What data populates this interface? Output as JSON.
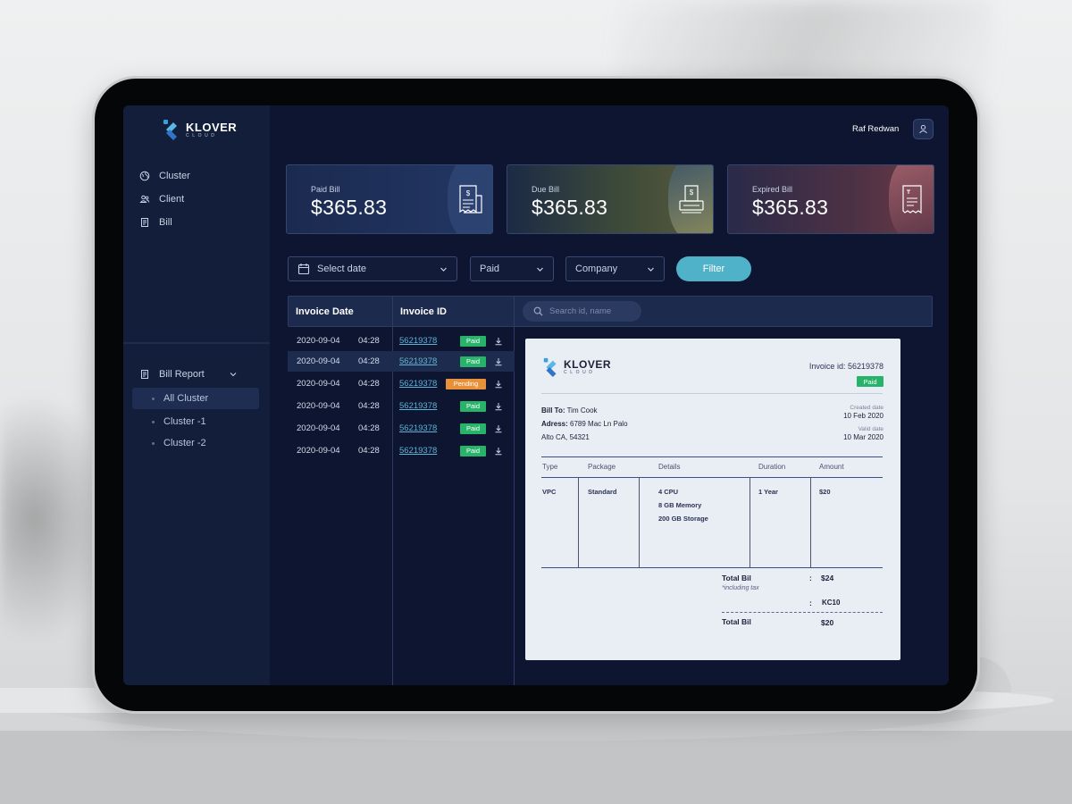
{
  "brand": {
    "name": "KLOVER",
    "sub": "CLOUD"
  },
  "sidebar": {
    "items": [
      {
        "label": "Cluster",
        "icon": "globe-icon"
      },
      {
        "label": "Client",
        "icon": "users-icon"
      },
      {
        "label": "Bill",
        "icon": "receipt-icon"
      }
    ],
    "report": {
      "label": "Bill Report",
      "children": [
        "All Cluster",
        "Cluster -1",
        "Cluster -2"
      ],
      "active": "All Cluster"
    }
  },
  "header": {
    "user_name": "Raf Redwan"
  },
  "cards": [
    {
      "label": "Paid Bill",
      "value": "$365.83"
    },
    {
      "label": "Due Bill",
      "value": "$365.83"
    },
    {
      "label": "Expired Bill",
      "value": "$365.83"
    }
  ],
  "filters": {
    "date_placeholder": "Select date",
    "status": "Paid",
    "company": "Company",
    "button": "Filter"
  },
  "table": {
    "headers": [
      "Invoice Date",
      "Invoice ID"
    ],
    "search_placeholder": "Search id, name",
    "rows": [
      {
        "date": "2020-09-04",
        "time": "04:28",
        "id": "56219378",
        "status": "Paid"
      },
      {
        "date": "2020-09-04",
        "time": "04:28",
        "id": "56219378",
        "status": "Paid"
      },
      {
        "date": "2020-09-04",
        "time": "04:28",
        "id": "56219378",
        "status": "Pending"
      },
      {
        "date": "2020-09-04",
        "time": "04:28",
        "id": "56219378",
        "status": "Paid"
      },
      {
        "date": "2020-09-04",
        "time": "04:28",
        "id": "56219378",
        "status": "Paid"
      },
      {
        "date": "2020-09-04",
        "time": "04:28",
        "id": "56219378",
        "status": "Paid"
      }
    ]
  },
  "invoice": {
    "id_text": "Invoice id: 56219378",
    "status": "Paid",
    "bill_to_label": "Bill To:",
    "bill_to": "Tim Cook",
    "address_label": "Adress:",
    "address_line1": "6789 Mac Ln Palo",
    "address_line2": "Alto CA, 54321",
    "created_label": "Created date",
    "created": "10 Feb 2020",
    "valid_label": "Valid date",
    "valid": "10 Mar 2020",
    "columns": [
      "Type",
      "Package",
      "Details",
      "Duration",
      "Amount"
    ],
    "item": {
      "type": "VPC",
      "package": "Standard",
      "details": [
        "4 CPU",
        "8 GB Memory",
        "200 GB Storage"
      ],
      "duration": "1 Year",
      "amount": "$20"
    },
    "total_label": "Total Bil",
    "total_note": "*including tax",
    "total": "$24",
    "code": "KC10",
    "final_label": "Total Bil",
    "final_total": "$20"
  },
  "colors": {
    "accent": "#4fb2c8",
    "paid": "#27b36a",
    "pending": "#e8913a",
    "link": "#5fb4d6",
    "sidebar": "#131e3a",
    "main": "#0d1530"
  }
}
